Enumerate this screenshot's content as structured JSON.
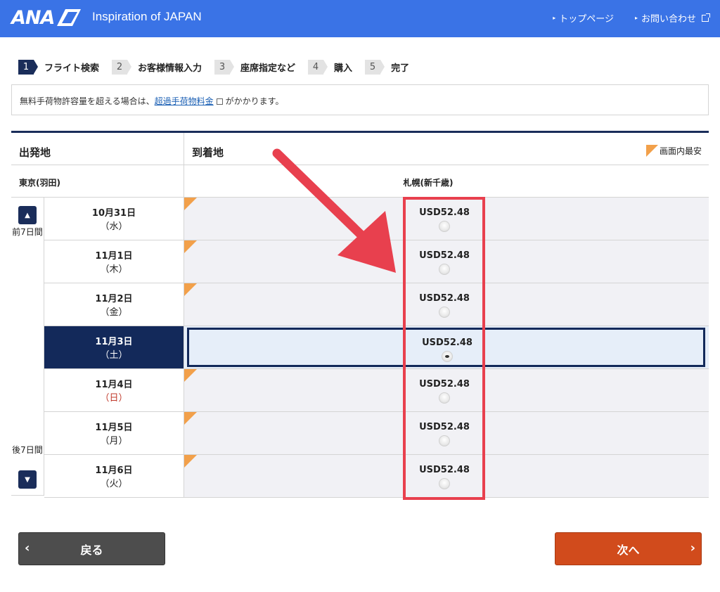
{
  "header": {
    "logo": "ANA",
    "tagline": "Inspiration of JAPAN",
    "links": [
      "トップページ",
      "お問い合わせ"
    ]
  },
  "steps": [
    {
      "num": "1",
      "label": "フライト検索",
      "active": true
    },
    {
      "num": "2",
      "label": "お客様情報入力"
    },
    {
      "num": "3",
      "label": "座席指定など"
    },
    {
      "num": "4",
      "label": "購入"
    },
    {
      "num": "5",
      "label": "完了"
    }
  ],
  "notice": {
    "before": "無料手荷物許容量を超える場合は、",
    "link": "超過手荷物料金",
    "after": "がかかります。"
  },
  "table": {
    "departure_header": "出発地",
    "arrival_header": "到着地",
    "legend": "画面内最安",
    "departure_city": "東京(羽田)",
    "arrival_city": "札幌(新千歳)",
    "prev_label": "前7日間",
    "next_label": "後7日間",
    "rows": [
      {
        "date": "10月31日",
        "dow": "（水）",
        "price": "USD52.48"
      },
      {
        "date": "11月1日",
        "dow": "（木）",
        "price": "USD52.48"
      },
      {
        "date": "11月2日",
        "dow": "（金）",
        "price": "USD52.48"
      },
      {
        "date": "11月3日",
        "dow": "（土）",
        "price": "USD52.48",
        "selected": true
      },
      {
        "date": "11月4日",
        "dow": "（日）",
        "price": "USD52.48"
      },
      {
        "date": "11月5日",
        "dow": "（月）",
        "price": "USD52.48"
      },
      {
        "date": "11月6日",
        "dow": "（火）",
        "price": "USD52.48"
      }
    ]
  },
  "buttons": {
    "back": "戻る",
    "next": "次へ"
  },
  "colors": {
    "header_bg": "#3a73e6",
    "navy": "#13295a",
    "cheapest_marker": "#f2a04a",
    "annotation": "#e8404e",
    "next_button": "#d14b1c",
    "back_button": "#4d4d4d"
  }
}
